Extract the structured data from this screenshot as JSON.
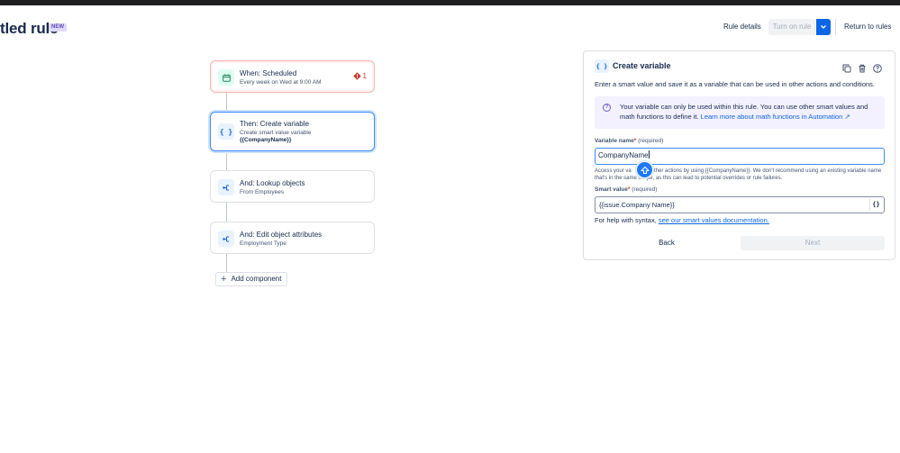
{
  "header": {
    "title": "tled rule",
    "badge": "NEW",
    "rule_details": "Rule details",
    "turn_on": "Turn on rule",
    "return": "Return to rules"
  },
  "flow": {
    "cards": [
      {
        "title": "When: Scheduled",
        "subtitle": "Every week on Wed at 9:00 AM",
        "icon": "calendar-icon",
        "error_count": "1"
      },
      {
        "title": "Then: Create variable",
        "subtitle": "Create smart value variable",
        "value": "{{CompanyName}}",
        "icon": "braces-icon"
      },
      {
        "title": "And: Lookup objects",
        "subtitle": "From Employees",
        "icon": "branch-icon"
      },
      {
        "title": "And: Edit object attributes",
        "subtitle": "Employment Type",
        "icon": "branch-icon"
      }
    ],
    "add_component": "Add component"
  },
  "panel": {
    "icon_text": "{ }",
    "title": "Create variable",
    "description": "Enter a smart value and save it as a variable that can be used in other actions and conditions.",
    "info_text": "Your variable can only be used within this rule. You can use other smart values and math functions to define it.",
    "info_link": "Learn more about math functions in Automation ↗",
    "name_label": "Variable name",
    "required_marker": "*",
    "required_text": "(required)",
    "name_value": "CompanyName",
    "name_help_a": "Access your va",
    "name_help_b": "other actions by using {{CompanyName}}. We don't recommend using an existing variable name that's in the same scope, as this can lead to potential overrides or rule failures.",
    "smart_label": "Smart value",
    "smart_value": "{{issue.Company Name}}",
    "smart_btn": "{}",
    "syntax_text": "For help with syntax,",
    "syntax_link": "see our smart values documentation.",
    "back": "Back",
    "next": "Next"
  },
  "colors": {
    "accent": "#0c66e4",
    "error": "#c9372c",
    "badge_bg": "#dfd8fd",
    "info_bg": "#f3f0ff"
  }
}
